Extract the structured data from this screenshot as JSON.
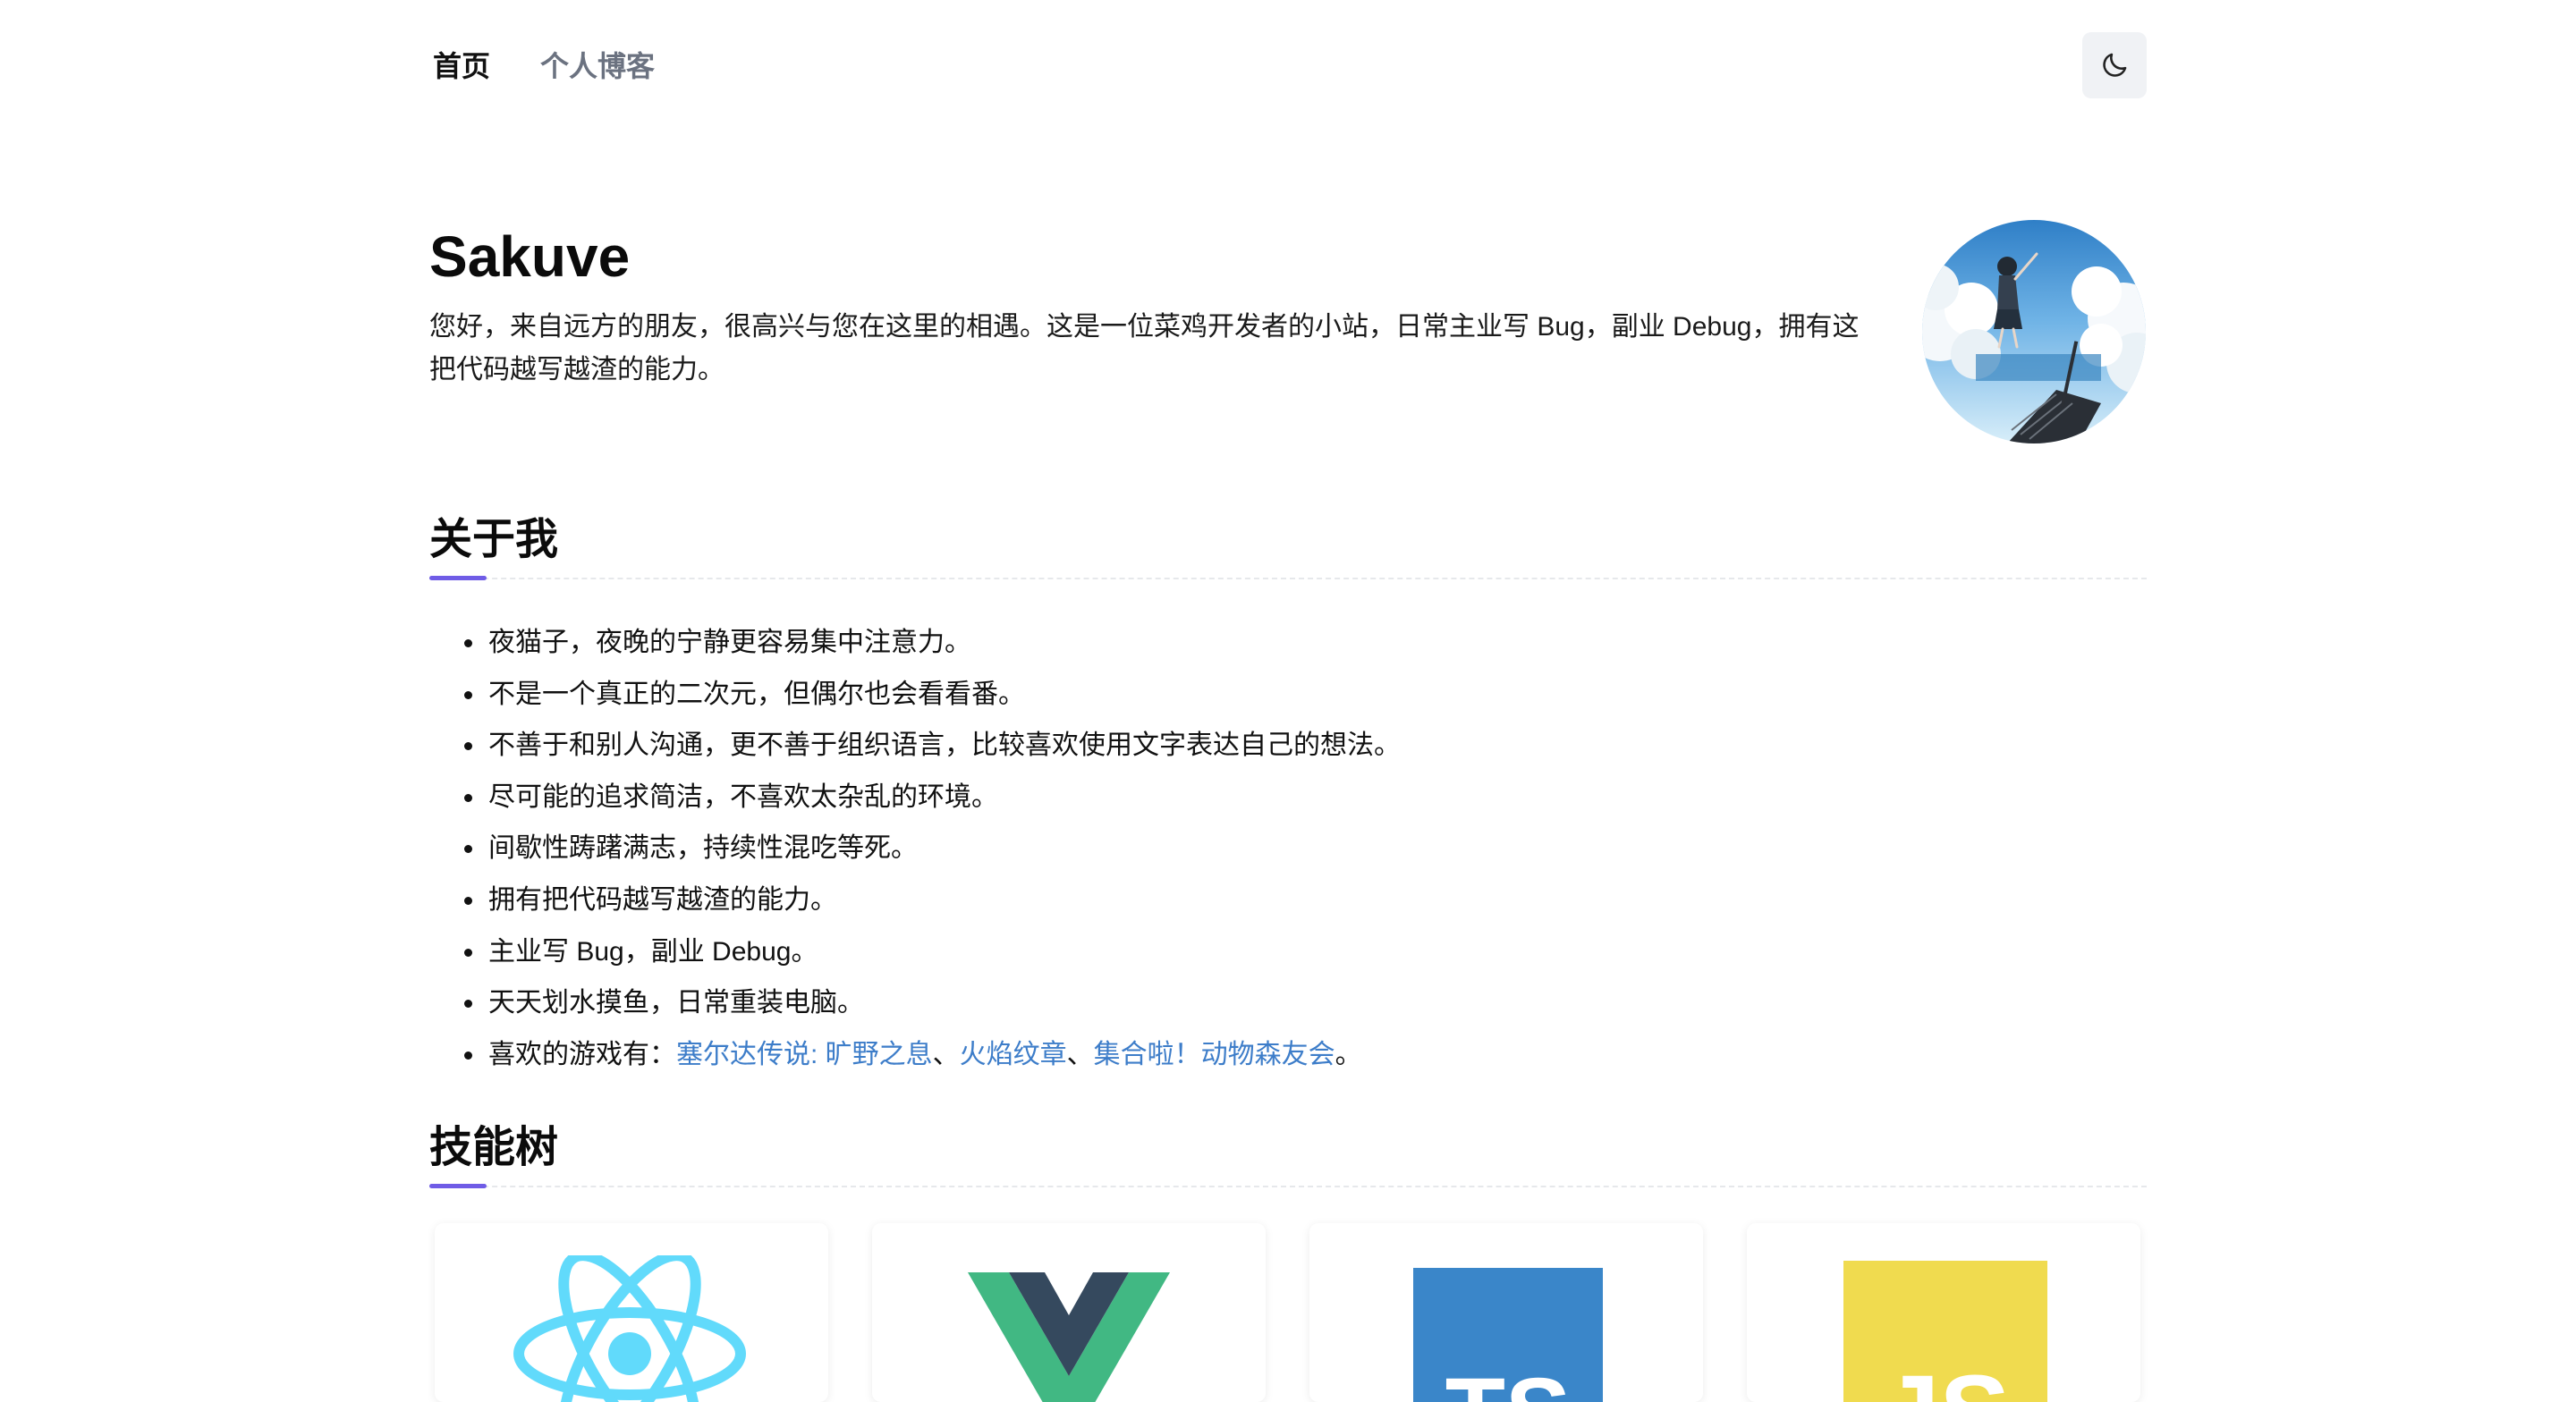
{
  "nav": {
    "home_label": "首页",
    "blog_label": "个人博客",
    "theme_toggle_icon": "moon-icon"
  },
  "hero": {
    "name": "Sakuve",
    "intro": "您好，来自远方的朋友，很高兴与您在这里的相遇。这是一位菜鸡开发者的小站，日常主业写 Bug，副业 Debug，拥有这把代码越写越渣的能力。",
    "avatar": "avatar-anime-girl-sky"
  },
  "about": {
    "title": "关于我",
    "items": [
      "夜猫子，夜晚的宁静更容易集中注意力。",
      "不是一个真正的二次元，但偶尔也会看看番。",
      "不善于和别人沟通，更不善于组织语言，比较喜欢使用文字表达自己的想法。",
      "尽可能的追求简洁，不喜欢太杂乱的环境。",
      "间歇性踌躇满志，持续性混吃等死。",
      "拥有把代码越写越渣的能力。",
      "主业写 Bug，副业 Debug。",
      "天天划水摸鱼，日常重装电脑。"
    ],
    "games": {
      "prefix": "喜欢的游戏有：",
      "links": [
        "塞尔达传说: 旷野之息",
        "火焰纹章",
        "集合啦！动物森友会"
      ],
      "sep1": "、",
      "sep2": "、",
      "suffix": "。"
    }
  },
  "skills": {
    "title": "技能树",
    "cards": [
      {
        "name": "React",
        "icon": "react-icon",
        "color": "#61dafb"
      },
      {
        "name": "Vue",
        "icon": "vue-icon",
        "color": "#41b883"
      },
      {
        "name": "TypeScript",
        "icon": "typescript-icon",
        "color": "#3178c6"
      },
      {
        "name": "JavaScript",
        "icon": "javascript-icon",
        "color": "#f0db4f"
      }
    ]
  },
  "colors": {
    "accent": "#6f5ce6",
    "link": "#3d7dc9",
    "nav_inactive": "#6b7280",
    "theme_button_bg": "#f0f2f5"
  }
}
